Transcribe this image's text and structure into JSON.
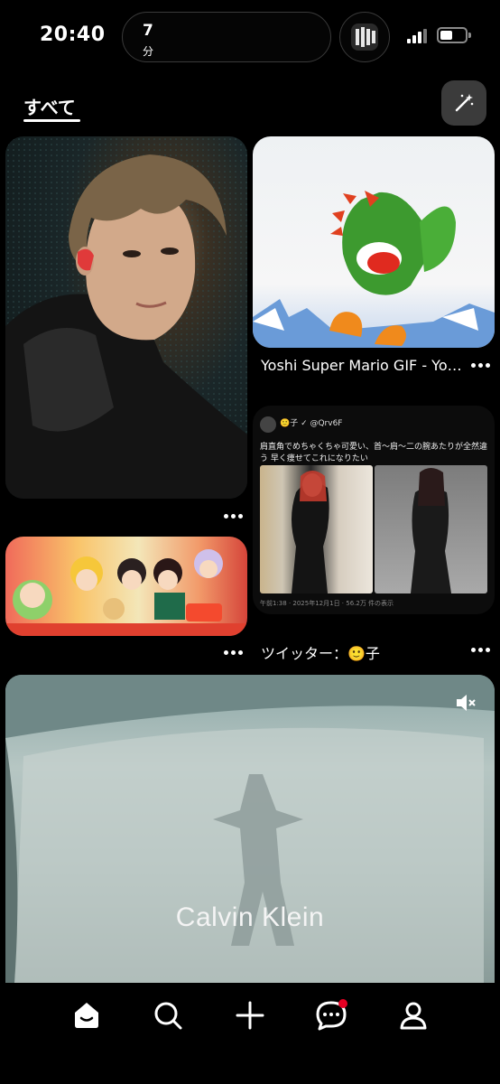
{
  "status_bar": {
    "time": "20:40",
    "island_value": "7",
    "island_unit": "分"
  },
  "header": {
    "tab_all": "すべて"
  },
  "pins": {
    "yoshi_caption": "Yoshi Super Mario GIF - Yo…",
    "tweet_caption": "ツイッター：🙂子",
    "tweet": {
      "handle": "🙂子 ✓ @Qrv6F",
      "text": "肩直角でめちゃくちゃ可愛い、首〜肩〜二の腕あたりが全然違う 早く痩せてこれになりたい",
      "meta": "午前1:38 · 2025年12月1日 · 56.2万 件の表示"
    },
    "video_logo": "Calvin Klein"
  },
  "colors": {
    "background": "#000000",
    "notification": "#e60023"
  }
}
